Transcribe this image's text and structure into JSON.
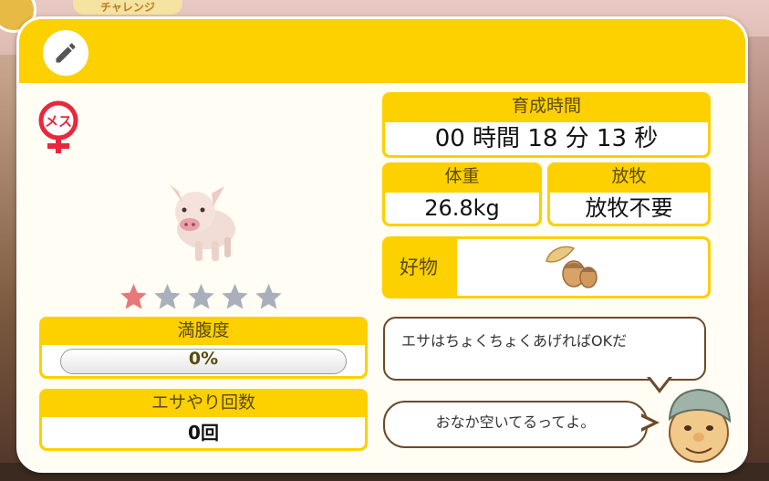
{
  "background": {
    "badge_text": "チャレンジ"
  },
  "header": {
    "edit_icon": "pencil-icon"
  },
  "pet": {
    "gender_label": "メス",
    "gender_icon": "female-icon",
    "rating": 1,
    "rating_max": 5
  },
  "fullness": {
    "label": "満腹度",
    "value_text": "0%",
    "value": 0
  },
  "feed_count": {
    "label": "エサやり回数",
    "value_text": "0回"
  },
  "growth_time": {
    "label": "育成時間",
    "value_text": "00 時間 18 分 13 秒"
  },
  "weight": {
    "label": "体重",
    "value_text": "26.8kg"
  },
  "grazing": {
    "label": "放牧",
    "value_text": "放牧不要"
  },
  "favorite": {
    "label": "好物",
    "item_icon": "acorn-icon"
  },
  "speech": {
    "line1": "エサはちょくちょくあげればOKだ",
    "line2": "おなか空いてるってよ。"
  },
  "colors": {
    "accent_yellow": "#fdd000",
    "star_active": "#e7787a",
    "star_inactive": "#a9b0bb",
    "female_red": "#e8283c"
  }
}
